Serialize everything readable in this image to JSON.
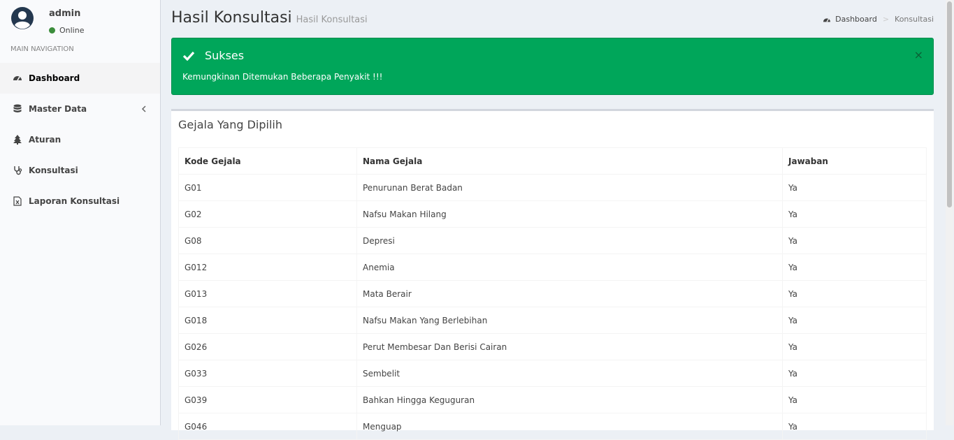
{
  "user": {
    "name": "admin",
    "status": "Online"
  },
  "nav": {
    "header": "MAIN NAVIGATION",
    "items": [
      {
        "label": "Dashboard",
        "icon": "dashboard-icon",
        "active": true
      },
      {
        "label": "Master Data",
        "icon": "database-icon",
        "has_children": true
      },
      {
        "label": "Aturan",
        "icon": "tree-icon"
      },
      {
        "label": "Konsultasi",
        "icon": "stethoscope-icon"
      },
      {
        "label": "Laporan Konsultasi",
        "icon": "file-excel-icon"
      }
    ]
  },
  "header": {
    "title": "Hasil Konsultasi",
    "subtitle": "Hasil Konsultasi"
  },
  "breadcrumb": {
    "home": "Dashboard",
    "separator": ">",
    "current": "Konsultasi"
  },
  "alert": {
    "title": "Sukses",
    "message": "Kemungkinan Ditemukan Beberapa Penyakit !!!",
    "close": "×",
    "color": "#00a65a"
  },
  "box": {
    "title": "Gejala Yang Dipilih",
    "columns": [
      "Kode Gejala",
      "Nama Gejala",
      "Jawaban"
    ],
    "rows": [
      [
        "G01",
        "Penurunan Berat Badan",
        "Ya"
      ],
      [
        "G02",
        "Nafsu Makan Hilang",
        "Ya"
      ],
      [
        "G08",
        "Depresi",
        "Ya"
      ],
      [
        "G012",
        "Anemia",
        "Ya"
      ],
      [
        "G013",
        "Mata Berair",
        "Ya"
      ],
      [
        "G018",
        "Nafsu Makan Yang Berlebihan",
        "Ya"
      ],
      [
        "G026",
        "Perut Membesar Dan Berisi Cairan",
        "Ya"
      ],
      [
        "G033",
        "Sembelit",
        "Ya"
      ],
      [
        "G039",
        "Bahkan Hingga Keguguran",
        "Ya"
      ],
      [
        "G046",
        "Menguap",
        "Ya"
      ]
    ]
  }
}
